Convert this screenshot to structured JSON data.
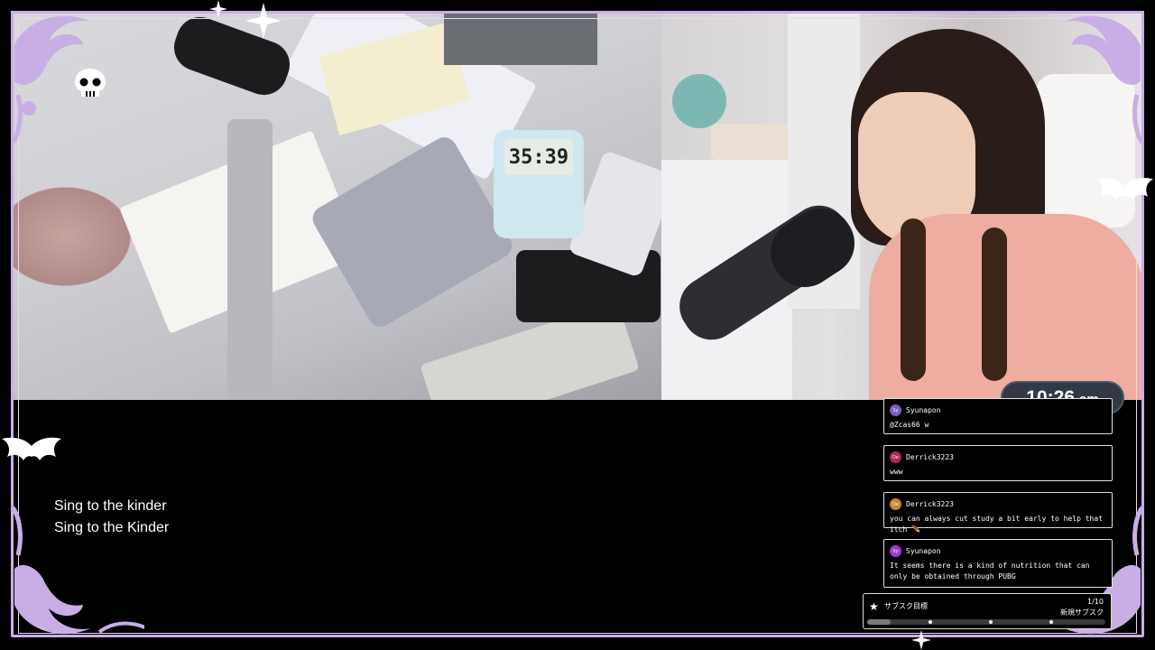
{
  "lyrics": {
    "line1": "Sing to the kinder",
    "line2": "Sing to the Kinder"
  },
  "desk_timer": {
    "display": "35:39"
  },
  "clock": {
    "time": "10:26",
    "ampm": "am"
  },
  "chat": {
    "messages": [
      {
        "user": "Syunapon",
        "avatar_text": "Sy",
        "avatar_color": "#7a5fc0",
        "text": "@Zcas66 w"
      },
      {
        "user": "Derrick3223",
        "avatar_text": "De",
        "avatar_color": "#b2274e",
        "text": "www"
      },
      {
        "user": "Derrick3223",
        "avatar_text": "De",
        "avatar_color": "#c8862b",
        "text": "you can always cut study a bit early to help that itch 🪶"
      },
      {
        "user": "Syunapon",
        "avatar_text": "Sy",
        "avatar_color": "#a33ad6",
        "text": "It seems there is a kind of nutrition that can only be obtained through PUBG"
      }
    ]
  },
  "sub_goal": {
    "title": "サブスク目標",
    "count": "1/10",
    "subtitle": "新規サブスク",
    "progress": 0.1
  },
  "colors": {
    "frame": "#c9aee6",
    "clock_bg": "#2f3a46"
  },
  "icons": {
    "skull": "skull-icon",
    "bat": "bat-icon",
    "star": "star-icon"
  }
}
